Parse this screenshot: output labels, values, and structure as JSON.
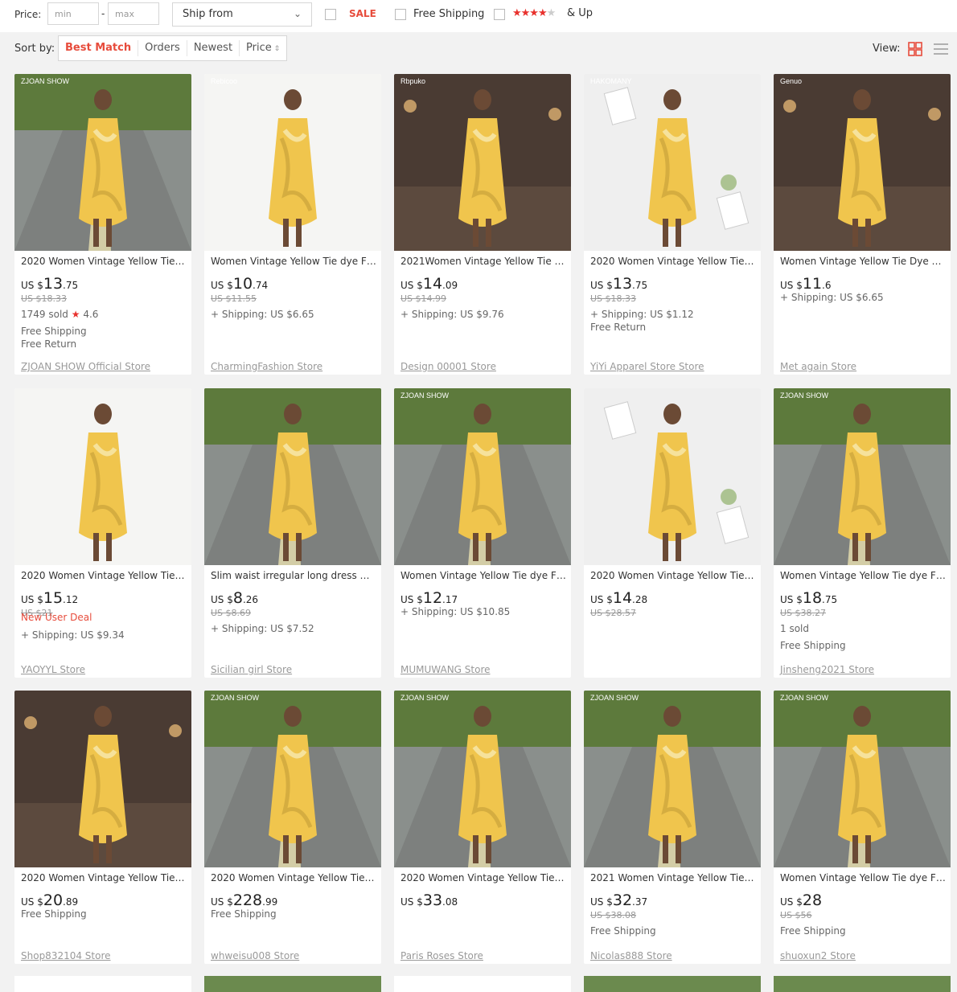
{
  "filters": {
    "price_label": "Price:",
    "min_placeholder": "min",
    "max_placeholder": "max",
    "dash": "-",
    "ship_from": "Ship from",
    "sale_label": "SALE",
    "free_shipping_label": "Free Shipping",
    "rating_label": "& Up",
    "rating_stars": 4
  },
  "sort": {
    "label": "Sort by:",
    "options": [
      "Best Match",
      "Orders",
      "Newest",
      "Price"
    ],
    "active": "Best Match",
    "view_label": "View:"
  },
  "colors": {
    "accent": "#e74c3c",
    "star": "#e8312d",
    "background": "#f2f2f2"
  },
  "products": [
    {
      "title": "2020 Women Vintage Yellow Tie dye Floral Print Satin Dress",
      "currency": "US $",
      "price_int": "13",
      "price_dec": ".75",
      "orig": "US $18.33",
      "sold": "1749 sold",
      "rating": "4.6",
      "deal": "",
      "extras": [
        "Free Shipping",
        "Free Return"
      ],
      "store": "ZJOAN SHOW Official Store",
      "scene": "road",
      "brand": "ZJOAN SHOW"
    },
    {
      "title": "Women Vintage Yellow Tie dye Floral Print Satin Dress",
      "currency": "US $",
      "price_int": "10",
      "price_dec": ".74",
      "orig": "US $11.55",
      "sold": "",
      "rating": "",
      "deal": "",
      "extras": [
        "+ Shipping: US $6.65"
      ],
      "store": "CharmingFashion Store",
      "scene": "white",
      "brand": "Rebicoo"
    },
    {
      "title": "2021Women Vintage Yellow Tie Dye Floral Print Satin Dress",
      "currency": "US $",
      "price_int": "14",
      "price_dec": ".09",
      "orig": "US $14.99",
      "sold": "",
      "rating": "",
      "deal": "",
      "extras": [
        "+ Shipping: US $9.76"
      ],
      "store": "Design 00001 Store",
      "scene": "dark",
      "brand": "Rbpuko"
    },
    {
      "title": "2020 Women Vintage Yellow Tie dye Floral Print Satin Dress",
      "currency": "US $",
      "price_int": "13",
      "price_dec": ".75",
      "orig": "US $18.33",
      "sold": "",
      "rating": "",
      "deal": "",
      "extras": [
        "+ Shipping: US $1.12",
        "Free Return"
      ],
      "store": "YiYi Apparel Store Store",
      "scene": "flat",
      "brand": "HAKOMANY"
    },
    {
      "title": "Women Vintage Yellow Tie Dye Floral Print Satin Dress",
      "currency": "US $",
      "price_int": "11",
      "price_dec": ".6",
      "orig": "",
      "sold": "",
      "rating": "",
      "deal": "",
      "extras": [
        "+ Shipping: US $6.65"
      ],
      "store": "Met again Store",
      "scene": "dark",
      "brand": "Genuo"
    },
    {
      "title": "2020 Women Vintage Yellow Tie dye Floral Print Satin Dress",
      "currency": "US $",
      "price_int": "15",
      "price_dec": ".12",
      "orig": "US $21",
      "sold": "",
      "rating": "",
      "deal": "New User Deal",
      "extras": [
        "+ Shipping: US $9.34"
      ],
      "store": "YAOYYL Store",
      "scene": "white",
      "brand": ""
    },
    {
      "title": "Slim waist irregular long dress with floral print",
      "currency": "US $",
      "price_int": "8",
      "price_dec": ".26",
      "orig": "US $8.69",
      "sold": "",
      "rating": "",
      "deal": "",
      "extras": [
        "+ Shipping: US $7.52"
      ],
      "store": "Sicilian girl Store",
      "scene": "road",
      "brand": ""
    },
    {
      "title": "Women Vintage Yellow Tie dye Floral Print Satin Dress",
      "currency": "US $",
      "price_int": "12",
      "price_dec": ".17",
      "orig": "",
      "sold": "",
      "rating": "",
      "deal": "",
      "extras": [
        "+ Shipping: US $10.85"
      ],
      "store": "MUMUWANG Store",
      "scene": "road",
      "brand": "ZJOAN SHOW"
    },
    {
      "title": "2020 Women Vintage Yellow Tie dye Floral Print Satin Dress",
      "currency": "US $",
      "price_int": "14",
      "price_dec": ".28",
      "orig": "US $28.57",
      "sold": "",
      "rating": "",
      "deal": "",
      "extras": [],
      "store": "",
      "scene": "flat",
      "brand": ""
    },
    {
      "title": "Women Vintage Yellow Tie dye Floral Print Satin Dress",
      "currency": "US $",
      "price_int": "18",
      "price_dec": ".75",
      "orig": "US $38.27",
      "sold": "1 sold",
      "rating": "",
      "deal": "",
      "extras": [
        "Free Shipping"
      ],
      "store": "Jinsheng2021 Store",
      "scene": "road",
      "brand": "ZJOAN SHOW"
    },
    {
      "title": "2020 Women Vintage Yellow Tie dye Floral Print Satin Dress",
      "currency": "US $",
      "price_int": "20",
      "price_dec": ".89",
      "orig": "",
      "sold": "",
      "rating": "",
      "deal": "",
      "extras": [
        "Free Shipping"
      ],
      "store": "Shop832104 Store",
      "scene": "dark",
      "brand": ""
    },
    {
      "title": "2020 Women Vintage Yellow Tie dye Floral Print Satin Dress",
      "currency": "US $",
      "price_int": "228",
      "price_dec": ".99",
      "orig": "",
      "sold": "",
      "rating": "",
      "deal": "",
      "extras": [
        "Free Shipping"
      ],
      "store": "whweisu008 Store",
      "scene": "road",
      "brand": "ZJOAN SHOW"
    },
    {
      "title": "2020 Women Vintage Yellow Tie dye Floral Print Satin Dress",
      "currency": "US $",
      "price_int": "33",
      "price_dec": ".08",
      "orig": "",
      "sold": "",
      "rating": "",
      "deal": "",
      "extras": [],
      "store": "Paris Roses Store",
      "scene": "road",
      "brand": "ZJOAN SHOW"
    },
    {
      "title": "2021 Women Vintage Yellow Tie dye Floral Print Satin Dress",
      "currency": "US $",
      "price_int": "32",
      "price_dec": ".37",
      "orig": "US $38.08",
      "sold": "",
      "rating": "",
      "deal": "",
      "extras": [
        "Free Shipping"
      ],
      "store": "Nicolas888 Store",
      "scene": "road",
      "brand": "ZJOAN SHOW"
    },
    {
      "title": "Women Vintage Yellow Tie dye Floral Print Satin Dress",
      "currency": "US $",
      "price_int": "28",
      "price_dec": "",
      "orig": "US $56",
      "sold": "",
      "rating": "",
      "deal": "",
      "extras": [
        "Free Shipping"
      ],
      "store": "shuoxun2 Store",
      "scene": "road",
      "brand": "ZJOAN SHOW"
    }
  ]
}
